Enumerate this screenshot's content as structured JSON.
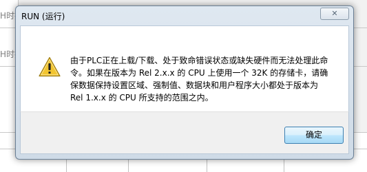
{
  "background": {
    "fragments": [
      "H时技",
      "H时技"
    ]
  },
  "dialog": {
    "title": "RUN (运行)",
    "close_glyph": "✕",
    "icon": "warning-icon",
    "message_lines": [
      "由于PLC正在上载/下载、处于致命错误状态或缺失硬件而无法处理此命",
      "令。如果在版本为 Rel 2.x.x 的 CPU 上使用一个 32K 的存储卡，请确",
      "保数据保持设置区域、强制值、数据块和用户程序大小都处于版本为",
      "Rel 1.x.x 的 CPU 所支持的范围之内。"
    ],
    "ok_label": "确定"
  },
  "colors": {
    "warning_fill": "#f2c531",
    "warning_stroke": "#9a7a10",
    "button_border": "#3c7fb1"
  }
}
